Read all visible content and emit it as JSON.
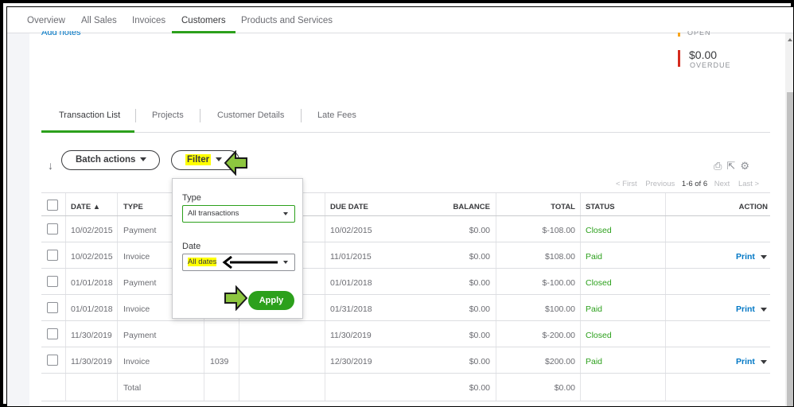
{
  "topnav": {
    "tabs": [
      "Overview",
      "All Sales",
      "Invoices",
      "Customers",
      "Products and Services"
    ],
    "active": "Customers"
  },
  "header": {
    "add_notes": "Add notes",
    "open_label": "OPEN",
    "overdue_amount": "$0.00",
    "overdue_label": "OVERDUE"
  },
  "subtabs": [
    "Transaction List",
    "Projects",
    "Customer Details",
    "Late Fees"
  ],
  "actions": {
    "batch_label": "Batch actions",
    "filter_label": "Filter"
  },
  "pager": {
    "first": "< First",
    "previous": "Previous",
    "current": "1-6 of 6",
    "next": "Next",
    "last": "Last >"
  },
  "table": {
    "headers": {
      "date": "DATE ▲",
      "type": "TYPE",
      "due_date": "DUE DATE",
      "balance": "BALANCE",
      "total": "TOTAL",
      "status": "STATUS",
      "action": "ACTION"
    },
    "rows": [
      {
        "date": "10/02/2015",
        "type": "Payment",
        "no": "",
        "due": "10/02/2015",
        "balance": "$0.00",
        "total": "$-108.00",
        "status": "Closed",
        "action": ""
      },
      {
        "date": "10/02/2015",
        "type": "Invoice",
        "no": "",
        "due": "11/01/2015",
        "balance": "$0.00",
        "total": "$108.00",
        "status": "Paid",
        "action": "Print"
      },
      {
        "date": "01/01/2018",
        "type": "Payment",
        "no": "",
        "due": "01/01/2018",
        "balance": "$0.00",
        "total": "$-100.00",
        "status": "Closed",
        "action": ""
      },
      {
        "date": "01/01/2018",
        "type": "Invoice",
        "no": "",
        "due": "01/31/2018",
        "balance": "$0.00",
        "total": "$100.00",
        "status": "Paid",
        "action": "Print"
      },
      {
        "date": "11/30/2019",
        "type": "Payment",
        "no": "",
        "due": "11/30/2019",
        "balance": "$0.00",
        "total": "$-200.00",
        "status": "Closed",
        "action": ""
      },
      {
        "date": "11/30/2019",
        "type": "Invoice",
        "no": "1039",
        "due": "12/30/2019",
        "balance": "$0.00",
        "total": "$200.00",
        "status": "Paid",
        "action": "Print"
      }
    ],
    "footer": {
      "label": "Total",
      "balance": "$0.00",
      "total": "$0.00"
    }
  },
  "filter_dropdown": {
    "type_label": "Type",
    "type_value": "All transactions",
    "date_label": "Date",
    "date_value": "All dates",
    "apply_label": "Apply"
  },
  "colors": {
    "accent_green": "#2ca01c",
    "link_blue": "#0077c5",
    "highlight": "#ffff00",
    "overdue_red": "#d52b1e",
    "open_orange": "#f7a51c",
    "annotation_arrow_green": "#8dc63f"
  },
  "icons": [
    "sort-icon",
    "print-icon",
    "export-icon",
    "settings-gear-icon",
    "chevron-down-icon"
  ]
}
